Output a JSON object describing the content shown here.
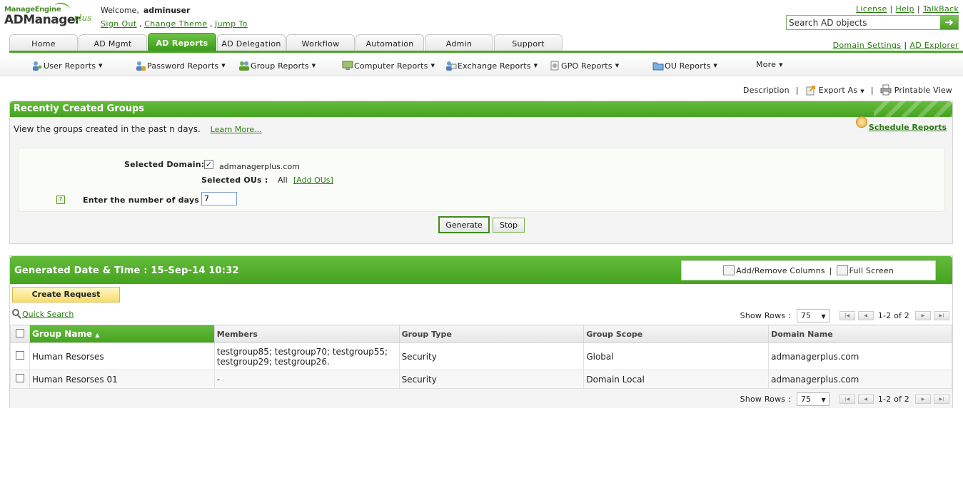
{
  "logo": {
    "company": "ManageEngine",
    "product": "ADManager",
    "suffix": "plus"
  },
  "header": {
    "welcome_label": "Welcome,",
    "username": "adminuser",
    "sign_out": "Sign Out",
    "change_theme": "Change Theme",
    "jump_to": "Jump To",
    "license": "License",
    "help": "Help",
    "talkback": "TalkBack",
    "search_value": "Search AD objects",
    "domain_settings": "Domain Settings",
    "ad_explorer": "AD Explorer"
  },
  "tabs": [
    "Home",
    "AD Mgmt",
    "AD Reports",
    "AD Delegation",
    "Workflow",
    "Automation",
    "Admin",
    "Support"
  ],
  "active_tab": "AD Reports",
  "report_menu": [
    "User Reports",
    "Password Reports",
    "Group Reports",
    "Computer Reports",
    "Exchange Reports",
    "GPO Reports",
    "OU Reports",
    "More"
  ],
  "actions": {
    "description": "Description",
    "export": "Export As",
    "print": "Printable View"
  },
  "report": {
    "title": "Recently Created Groups",
    "description": "View the groups created in the past n days.",
    "learn_more": "Learn More...",
    "schedule": "Schedule Reports",
    "selected_domain_label": "Selected Domain:",
    "domain": "admanagerplus.com",
    "selected_ous_label": "Selected OUs :",
    "ous_value": "All",
    "add_ous": "[Add OUs]",
    "days_label": "Enter the number of days :",
    "days_value": "7",
    "generate": "Generate",
    "stop": "Stop"
  },
  "results": {
    "generated": "Generated Date & Time : 15-Sep-14 10:32",
    "add_remove_columns": "Add/Remove Columns",
    "full_screen": "Full Screen",
    "create_request": "Create Request",
    "quick_search": "Quick Search",
    "show_rows_label": "Show Rows :",
    "rows_value": "75",
    "page_info": "1-2 of 2",
    "columns": [
      "Group Name",
      "Members",
      "Group Type",
      "Group Scope",
      "Domain Name"
    ],
    "rows": [
      {
        "group_name": "Human Resorses",
        "members_1": "testgroup85; testgroup70; testgroup55;",
        "members_2": "testgroup29; testgroup26.",
        "group_type": "Security",
        "group_scope": "Global",
        "domain": "admanagerplus.com"
      },
      {
        "group_name": "Human Resorses 01",
        "members_1": "-",
        "members_2": "",
        "group_type": "Security",
        "group_scope": "Domain Local",
        "domain": "admanagerplus.com"
      }
    ]
  },
  "colors": {
    "accent": "#4ea62a",
    "link": "#2a7a12"
  }
}
